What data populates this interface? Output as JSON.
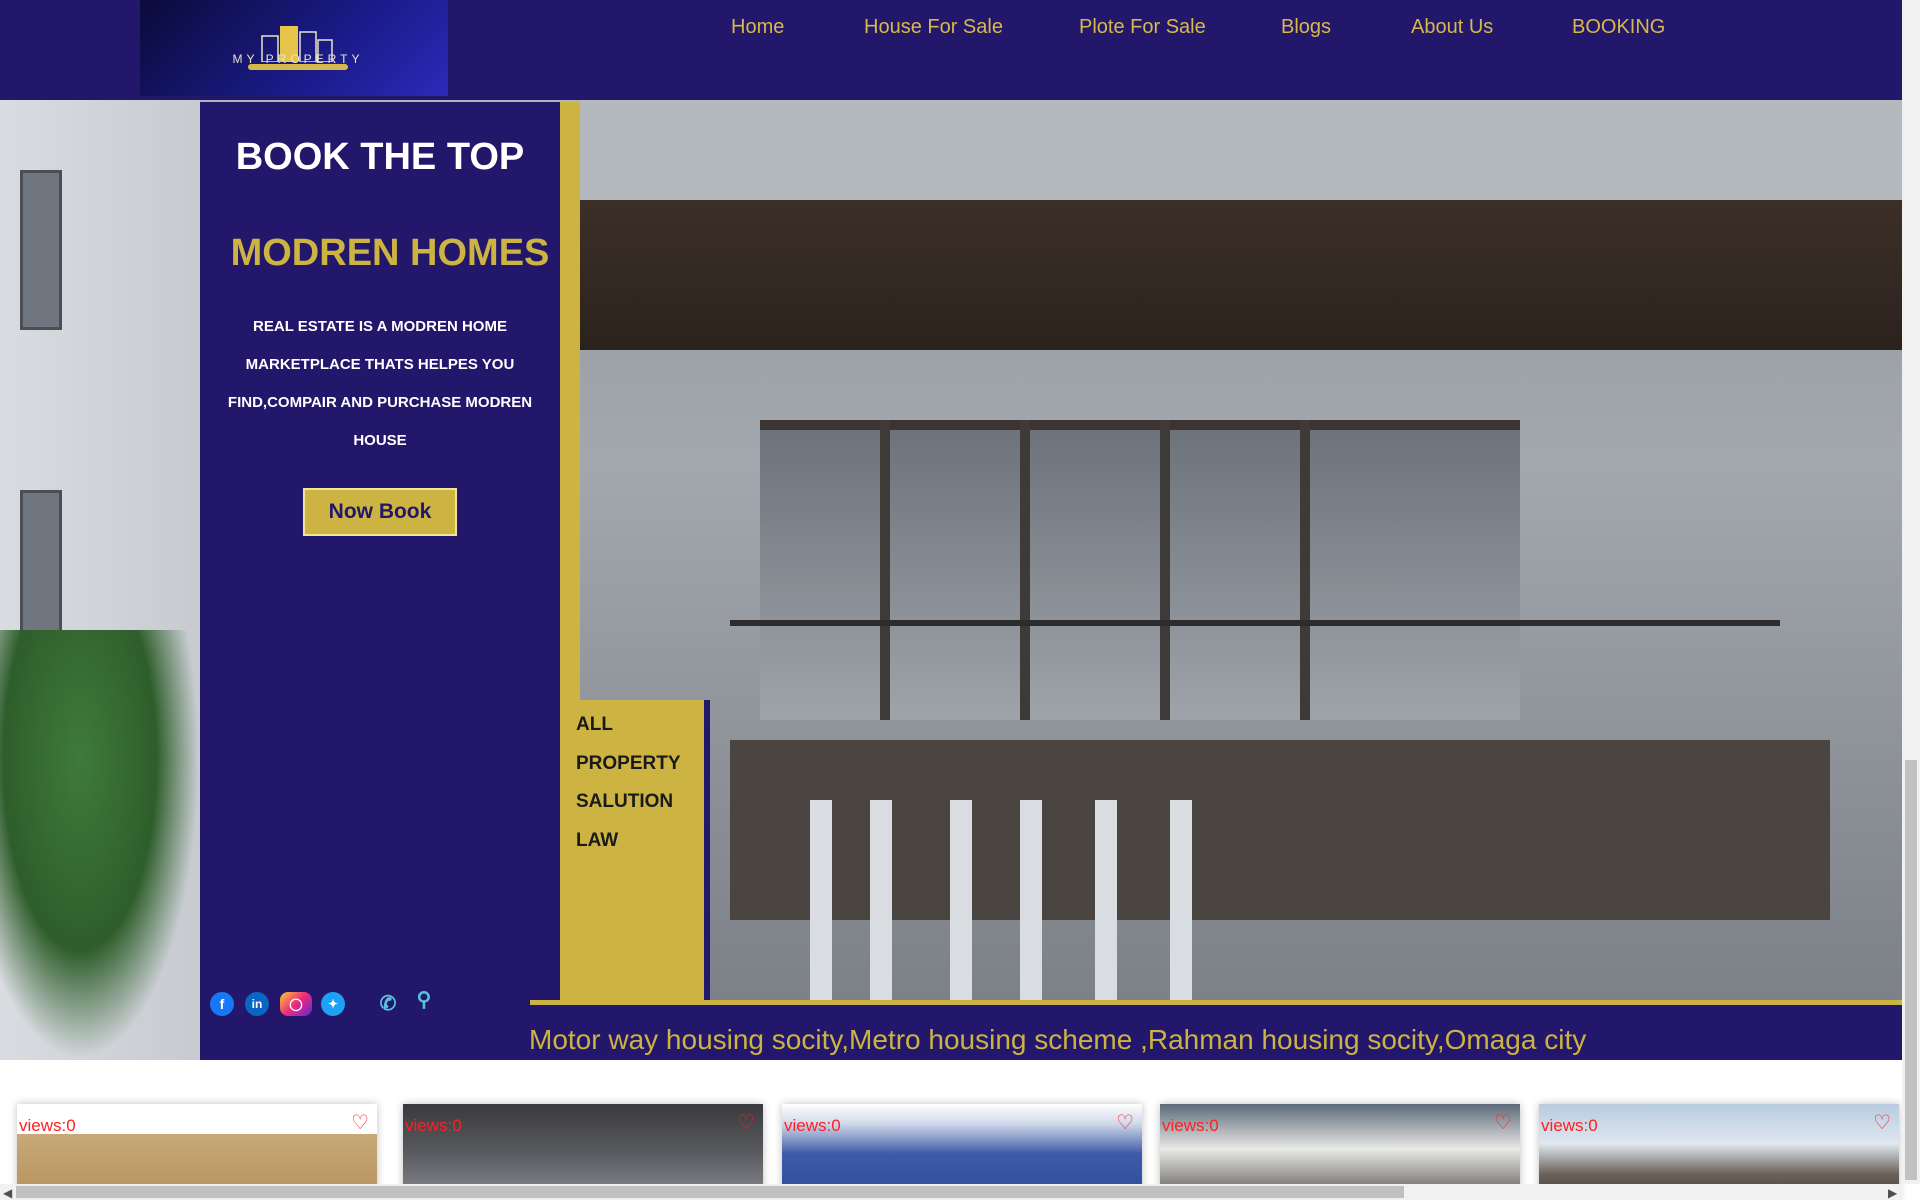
{
  "brand": {
    "logo_text": "MY PROPERTY",
    "colors": {
      "primary": "#22176a",
      "accent": "#cdb341"
    }
  },
  "nav": {
    "items": [
      {
        "label": "Home"
      },
      {
        "label": "House For Sale"
      },
      {
        "label": "Plote For Sale"
      },
      {
        "label": "Blogs"
      },
      {
        "label": "About Us"
      },
      {
        "label": "BOOKING"
      }
    ]
  },
  "hero": {
    "title_line1": "BOOK THE TOP",
    "title_line2": "MODREN HOMES",
    "description": "REAL ESTATE IS A MODREN HOME MARKETPLACE THATS HELPES YOU FIND,COMPAIR AND PURCHASE MODREN HOUSE",
    "button_label": "Now Book"
  },
  "side_menu": {
    "items": [
      "ALL",
      "PROPERTY",
      "SALUTION",
      "LAW"
    ]
  },
  "social": {
    "icons": [
      "facebook-icon",
      "linkedin-icon",
      "instagram-icon",
      "twitter-icon",
      "phone-icon",
      "location-pin-icon"
    ]
  },
  "ticker": {
    "text": "Motor way housing socity,Metro housing scheme ,Rahman housing socity,Omaga city"
  },
  "cards": [
    {
      "views": "views:0"
    },
    {
      "views": "views:0"
    },
    {
      "views": "views:0"
    },
    {
      "views": "views:0"
    },
    {
      "views": "views:0"
    }
  ]
}
